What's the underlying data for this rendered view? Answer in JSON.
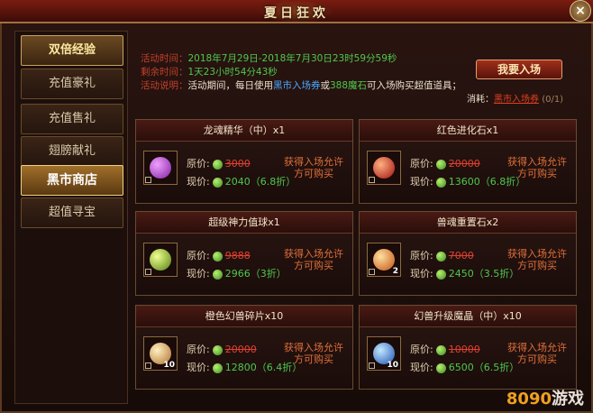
{
  "window": {
    "title": "夏日狂欢",
    "close_label": "×"
  },
  "sidebar": {
    "tabs": [
      {
        "label": "双倍经验"
      },
      {
        "label": "充值豪礼"
      },
      {
        "label": "充值售礼"
      },
      {
        "label": "翅膀献礼"
      },
      {
        "label": "黑市商店"
      },
      {
        "label": "超值寻宝"
      }
    ]
  },
  "info": {
    "time_label": "活动时间：",
    "time_value": "2018年7月29日-2018年7月30日23时59分59秒",
    "remain_label": "剩余时间：",
    "remain_value": "1天23小时54分43秒",
    "desc_label": "活动说明：",
    "desc_text_1": "活动期间，每日使用",
    "desc_ticket": "黑市入场券",
    "desc_text_2": "或",
    "desc_stone": "388魔石",
    "desc_text_3": "可入场购买超值道具；"
  },
  "enter_button": {
    "label": "我要入场"
  },
  "consume": {
    "label": "消耗：",
    "item": "黑市入场券",
    "count": "(0/1)"
  },
  "cards": [
    {
      "name": "龙魂精华（中）x1",
      "orig_label": "原价:",
      "orig_price": "3000",
      "now_label": "现价:",
      "now_price": "2040（6.8折）",
      "note": "获得入场允许方可购买",
      "qty": "",
      "gem_color": "#b040c0"
    },
    {
      "name": "红色进化石x1",
      "orig_label": "原价:",
      "orig_price": "20000",
      "now_label": "现价:",
      "now_price": "13600（6.8折）",
      "note": "获得入场允许方可购买",
      "qty": "",
      "gem_color": "#d03020"
    },
    {
      "name": "超级神力值球x1",
      "orig_label": "原价:",
      "orig_price": "9888",
      "now_label": "现价:",
      "now_price": "2966（3折）",
      "note": "获得入场允许方可购买",
      "qty": "",
      "gem_color": "#80d020"
    },
    {
      "name": "兽魂重置石x2",
      "orig_label": "原价:",
      "orig_price": "7000",
      "now_label": "现价:",
      "now_price": "2450（3.5折）",
      "note": "获得入场允许方可购买",
      "qty": "2",
      "gem_color": "#e08020"
    },
    {
      "name": "橙色幻兽碎片x10",
      "orig_label": "原价:",
      "orig_price": "20000",
      "now_label": "现价:",
      "now_price": "12800（6.4折）",
      "note": "获得入场允许方可购买",
      "qty": "10",
      "gem_color": "#e0a060"
    },
    {
      "name": "幻兽升级魔晶（中）x10",
      "orig_label": "原价:",
      "orig_price": "10000",
      "now_label": "现价:",
      "now_price": "6500（6.5折）",
      "note": "获得入场允许方可购买",
      "qty": "10",
      "gem_color": "#4090e0"
    }
  ],
  "watermark": {
    "num": "8090",
    "text": "游戏"
  }
}
